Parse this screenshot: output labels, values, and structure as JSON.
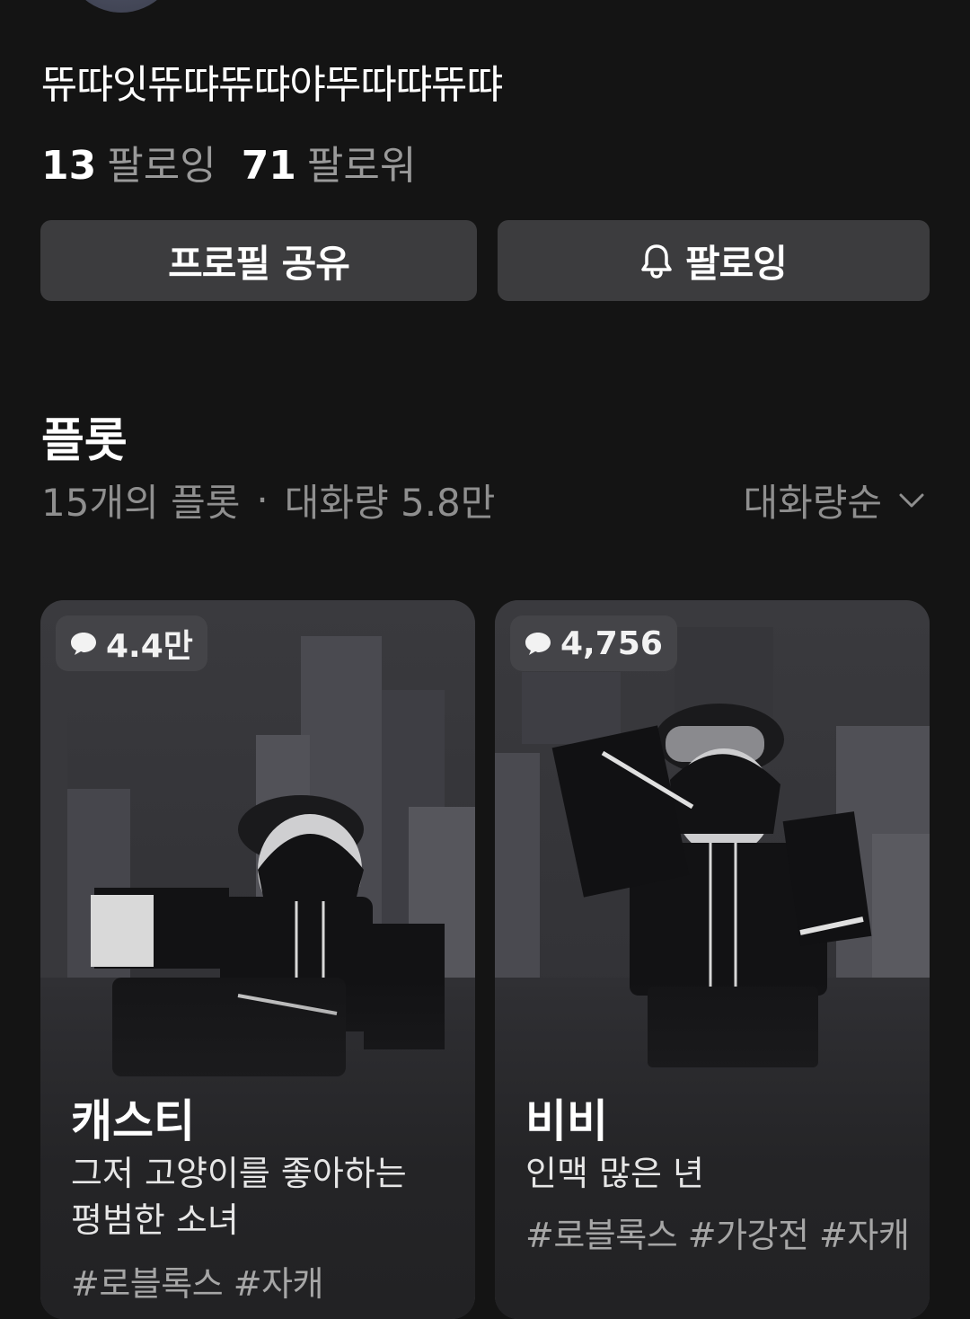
{
  "profile": {
    "name": "뜌땨잇뜌땨뜌땨야뚜따땨뜌땨",
    "following_count": "13",
    "following_label": "팔로잉",
    "followers_count": "71",
    "followers_label": "팔로워"
  },
  "actions": {
    "share_label": "프로필 공유",
    "follow_label": "팔로잉",
    "follow_icon": "bell-icon"
  },
  "plots_section": {
    "title": "플롯",
    "count_text": "15개의 플롯",
    "separator": "·",
    "volume_text": "대화량 5.8만",
    "sort_label": "대화량순",
    "sort_icon": "chevron-down-icon"
  },
  "cards": [
    {
      "comment_count": "4.4만",
      "name": "캐스티",
      "description": "그저 고양이를 좋아하는 평범한 소녀",
      "tags": "#로블록스 #자캐"
    },
    {
      "comment_count": "4,756",
      "name": "비비",
      "description": "인맥 많은 년",
      "tags": "#로블록스 #가강전 #자캐"
    }
  ],
  "colors": {
    "background": "#141414",
    "button_bg": "#3c3c3e",
    "muted_text": "#8f8f8f",
    "card_bg": "#2b2b2e"
  }
}
